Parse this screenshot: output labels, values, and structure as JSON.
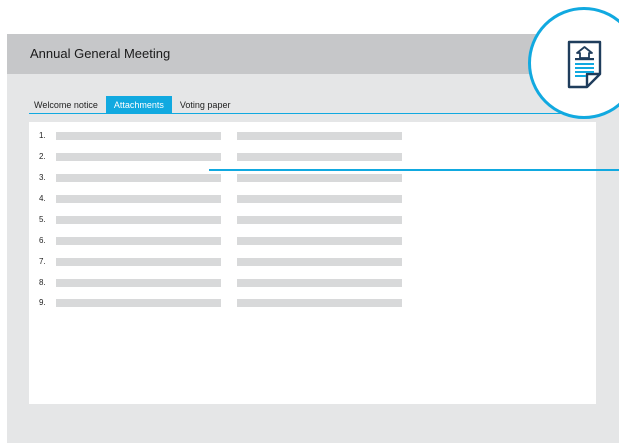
{
  "window": {
    "title": "Annual General Meeting"
  },
  "tabs": [
    {
      "label": "Welcome notice",
      "active": false
    },
    {
      "label": "Attachments",
      "active": true
    },
    {
      "label": "Voting paper",
      "active": false
    }
  ],
  "attachments": {
    "numbers": [
      "1.",
      "2.",
      "3.",
      "4.",
      "5.",
      "6.",
      "7.",
      "8.",
      "9."
    ]
  },
  "badge": {
    "icon": "document-with-home-icon"
  },
  "colors": {
    "accent": "#11a9e0",
    "title_bar": "#c6c7c9",
    "window_bg": "#e5e6e7",
    "placeholder": "#d8d9da",
    "icon_navy": "#1f3d5c"
  }
}
